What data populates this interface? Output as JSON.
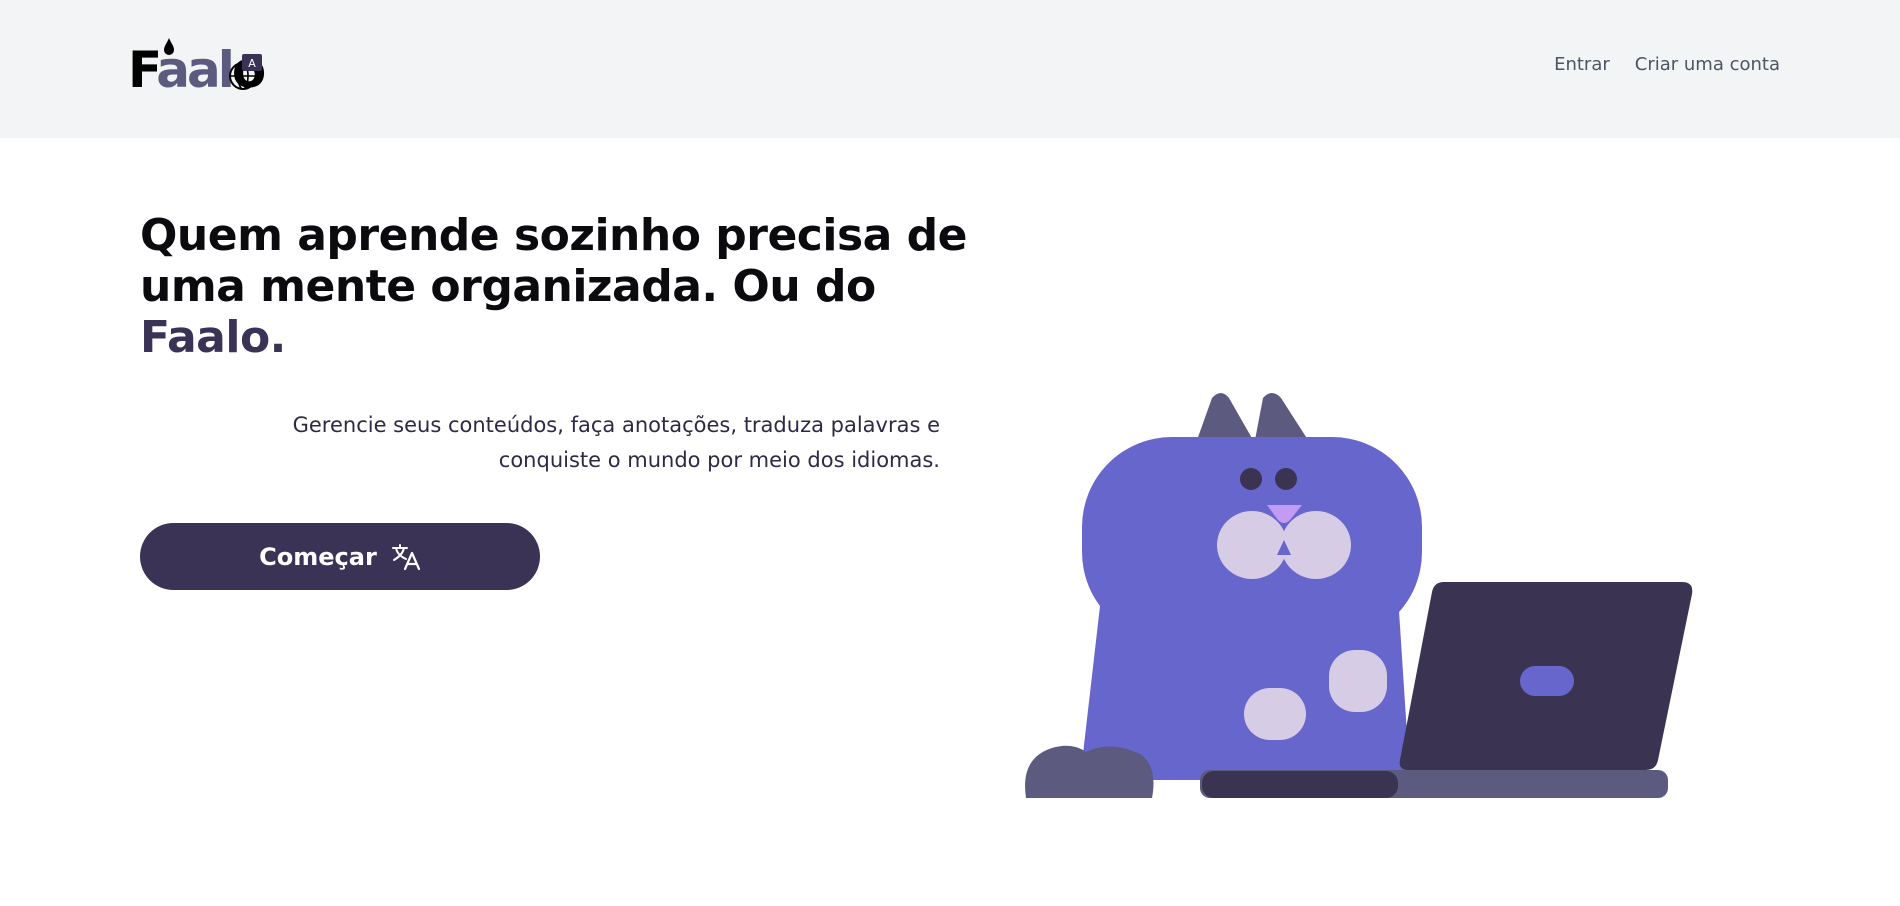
{
  "header": {
    "logo": {
      "text_prefix": "F",
      "text_mid": "aal",
      "text_suffix": "o",
      "icon": "translate-globe-icon"
    },
    "nav": {
      "login_label": "Entrar",
      "signup_label": "Criar uma conta"
    }
  },
  "hero": {
    "title_line1": "Quem aprende sozinho precisa de",
    "title_line2": "uma mente organizada. Ou do",
    "title_brand": "Faalo.",
    "subtitle": "Gerencie seus conteúdos, faça anotações, traduza palavras e conquiste o mundo por meio dos idiomas.",
    "cta_label": "Começar",
    "cta_icon": "translate-icon"
  },
  "colors": {
    "header_bg": "#f3f4f6",
    "brand_dark": "#3b3355",
    "cat_body": "#6766cc",
    "cat_ears": "#5c5a7e",
    "cat_patch": "#d6cce6",
    "cat_nose": "#c39bf5",
    "laptop": "#3a3352"
  }
}
